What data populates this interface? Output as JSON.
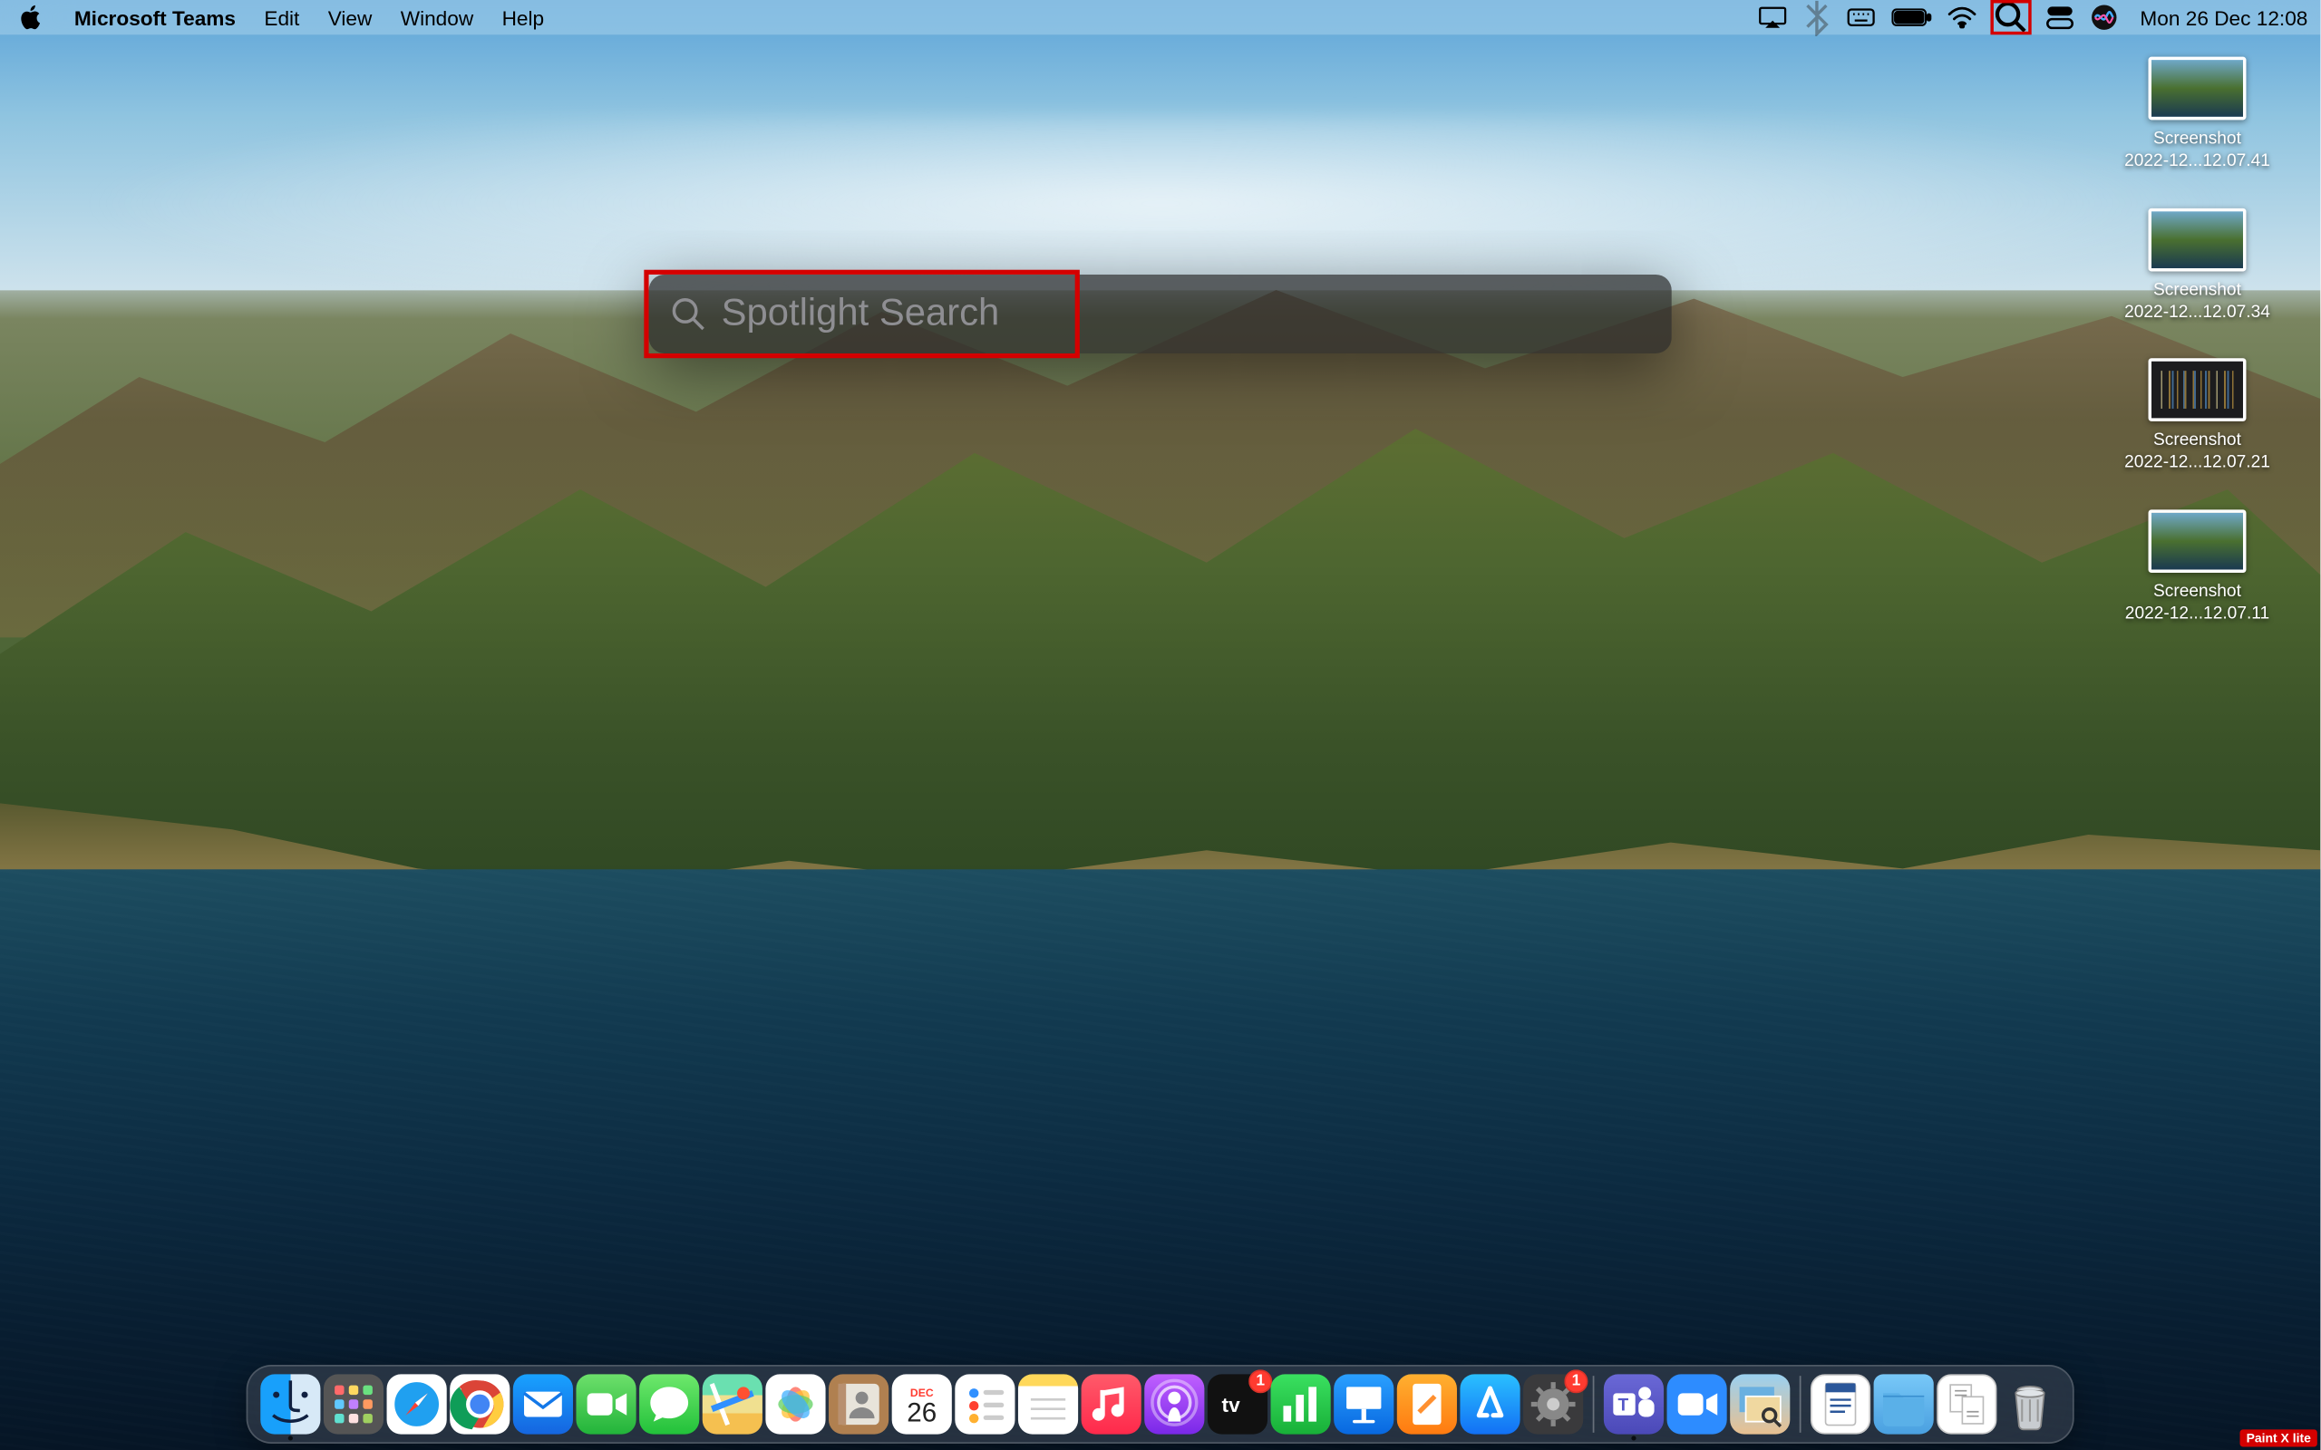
{
  "menubar": {
    "app_name": "Microsoft Teams",
    "items": [
      "Edit",
      "View",
      "Window",
      "Help"
    ],
    "clock": "Mon 26 Dec  12:08"
  },
  "spotlight": {
    "placeholder": "Spotlight Search"
  },
  "desktop_files": [
    {
      "line1": "Screenshot",
      "line2": "2022-12...12.07.41",
      "variant": "landscape"
    },
    {
      "line1": "Screenshot",
      "line2": "2022-12...12.07.34",
      "variant": "landscape"
    },
    {
      "line1": "Screenshot",
      "line2": "2022-12...12.07.21",
      "variant": "dark"
    },
    {
      "line1": "Screenshot",
      "line2": "2022-12...12.07.11",
      "variant": "landscape"
    }
  ],
  "calendar": {
    "month": "DEC",
    "day": "26"
  },
  "dock": {
    "appstore_badge": "1",
    "settings_badge": "1",
    "zoom_label": "zoom",
    "tv_label": "tv"
  },
  "watermark": "Paint X lite"
}
